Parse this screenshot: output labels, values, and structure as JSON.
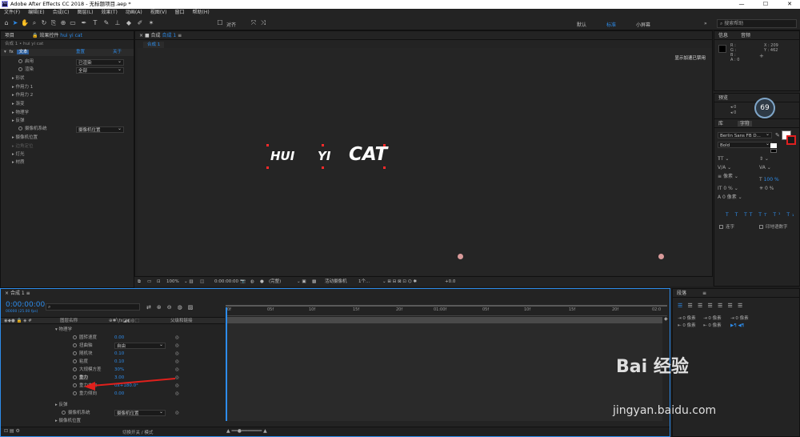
{
  "titlebar": {
    "title": "Adobe After Effects CC 2018 - 无标题项目.aep *",
    "app_icon": "Ae"
  },
  "menu": [
    "文件(F)",
    "编辑(E)",
    "合成(C)",
    "图层(L)",
    "效果(T)",
    "动画(A)",
    "视图(V)",
    "窗口",
    "帮助(H)"
  ],
  "toolbar": {
    "align_label": "对齐",
    "workspaces": [
      "默认",
      "标准",
      "小屏幕"
    ],
    "active_workspace": "标准",
    "search_placeholder": "搜索帮助"
  },
  "project_panel": {
    "tab_project": "项目",
    "tab_effects": "效果控件",
    "layer_name": "hui yi cat",
    "breadcrumb": "合成 1 • hui yi cat",
    "header": {
      "fx": "fx",
      "name": "文本",
      "reset": "重置",
      "about": "关于"
    },
    "rows": [
      {
        "label": "启用",
        "value": "已渲染"
      },
      {
        "label": "渲染",
        "value": "全部"
      },
      {
        "label": "形状"
      },
      {
        "label": "作用力 1"
      },
      {
        "label": "作用力 2"
      },
      {
        "label": "渐变"
      },
      {
        "label": "物理学"
      },
      {
        "label": "反弹"
      },
      {
        "label": "摄像机系统",
        "value": "摄像机位置"
      },
      {
        "label": "摄像机位置"
      },
      {
        "label": "边角定位"
      },
      {
        "label": "灯光"
      },
      {
        "label": "材质"
      }
    ]
  },
  "composition": {
    "tab_label": "合成",
    "comp_name": "合成 1",
    "comp_tab": "合成 1",
    "gpu_notice": "显示加速已禁用",
    "text_words": [
      "HUI",
      "YI",
      "CAT"
    ]
  },
  "viewer_bar": {
    "zoom": "100%",
    "timecode": "0:00:00:00",
    "resolution": "(完整)",
    "camera": "活动摄像机",
    "views": "1个...",
    "exposure": "+0.0"
  },
  "timeline": {
    "comp_tab": "合成 1",
    "timecode": "0:00:00:00",
    "fps": "00000 (25.00 fps)",
    "col_layer_name": "图层名称",
    "col_parent": "父级和链接",
    "ruler": [
      "0f",
      "05f",
      "10f",
      "15f",
      "20f",
      "01:00f",
      "05f",
      "10f",
      "15f",
      "20f",
      "02:0"
    ],
    "rows": [
      {
        "label": "物理学",
        "indent": 1,
        "type": "group"
      },
      {
        "label": "圆转速度",
        "value": "0.00",
        "indent": 2
      },
      {
        "label": "扭曲轴",
        "value": "自由",
        "indent": 2,
        "dropdown": true
      },
      {
        "label": "随机块",
        "value": "0.10",
        "indent": 2
      },
      {
        "label": "粘度",
        "value": "0.10",
        "indent": 2
      },
      {
        "label": "大规模方差",
        "value": "30%",
        "indent": 2
      },
      {
        "label": "重力",
        "value": "3.00",
        "indent": 2,
        "highlight": true
      },
      {
        "label": "重力方向",
        "value": "0x+180.0°",
        "indent": 2
      },
      {
        "label": "重力倾向",
        "value": "0.00",
        "indent": 2
      },
      {
        "label": "反弹",
        "indent": 1,
        "type": "group"
      },
      {
        "label": "摄像机系统",
        "value": "摄像机位置",
        "indent": 1,
        "dropdown": true
      },
      {
        "label": "摄像机位置",
        "indent": 1,
        "type": "group"
      }
    ],
    "footer_label": "切换开关 / 模式"
  },
  "right_panel": {
    "info_tab": "信息",
    "audio_tab": "音频",
    "info": {
      "r": "R :",
      "g": "G :",
      "b": "B :",
      "a": "A : 0",
      "x": "X : 209",
      "y": "Y : 462"
    },
    "preview_tab": "预览",
    "badge": "69",
    "char_tabs": [
      "库",
      "字符"
    ],
    "font": "Berlin Sans FB D...",
    "font_style": "Bold",
    "size_unit": "像素",
    "tracking_pct": "100 %",
    "scale_pct": "100 %",
    "baseline": "0 像素",
    "tsume": "0 %",
    "opt_ligature": "连字",
    "opt_hindi": "印地语数字"
  },
  "para_panel": {
    "tab": "段落",
    "indent_values": [
      "0 像素",
      "0 像素",
      "0 像素",
      "0 像素",
      "0 像素"
    ]
  },
  "watermark": {
    "brand": "Bai  经验",
    "url": "jingyan.baidu.com"
  }
}
